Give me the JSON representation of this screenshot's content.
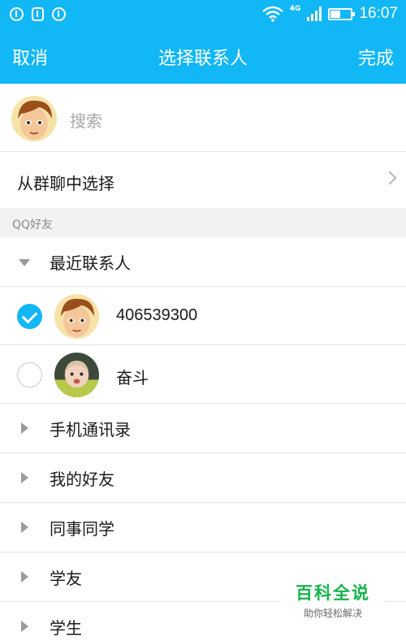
{
  "status_bar": {
    "network_type": "4G",
    "time": "16:07",
    "icons": [
      "notification-icon",
      "sim-icon",
      "alert-icon",
      "wifi-icon",
      "signal-icon",
      "battery-icon"
    ]
  },
  "nav": {
    "cancel_label": "取消",
    "title": "选择联系人",
    "done_label": "完成"
  },
  "search": {
    "placeholder": "搜索",
    "value": ""
  },
  "group_chat": {
    "label": "从群聊中选择"
  },
  "section": {
    "label": "QQ好友"
  },
  "groups": [
    {
      "label": "最近联系人",
      "expanded": true
    },
    {
      "label": "手机通讯录",
      "expanded": false
    },
    {
      "label": "我的好友",
      "expanded": false
    },
    {
      "label": "同事同学",
      "expanded": false
    },
    {
      "label": "学友",
      "expanded": false
    },
    {
      "label": "学生",
      "expanded": false
    }
  ],
  "contacts": [
    {
      "name": "406539300",
      "selected": true
    },
    {
      "name": "奋斗",
      "selected": false
    }
  ],
  "watermark": {
    "title": "百科全说",
    "subtitle": "助你轻松解决"
  },
  "colors": {
    "accent": "#12b7f5",
    "section_bg": "#f2f2f2",
    "divider": "#e2e2e2",
    "watermark_green": "#17b24b"
  }
}
